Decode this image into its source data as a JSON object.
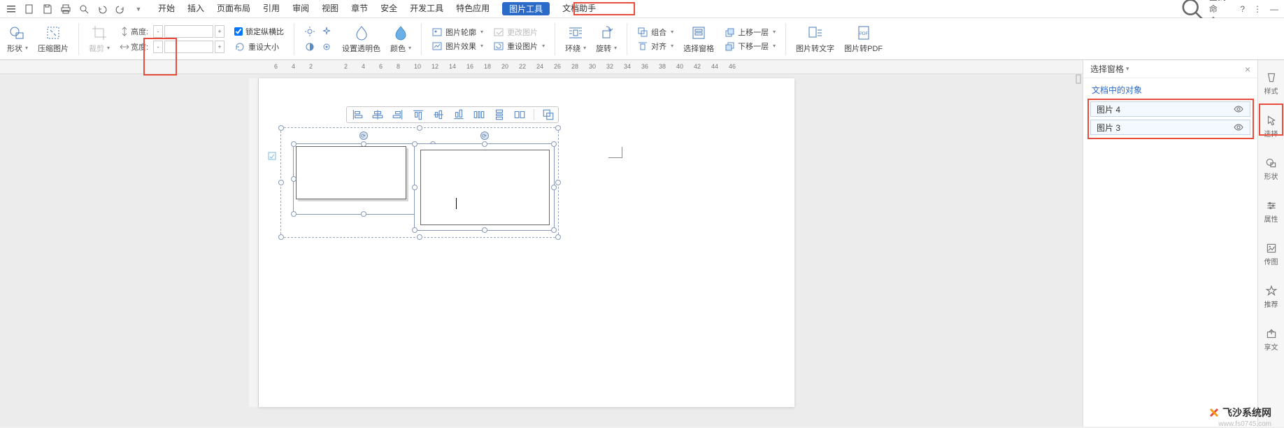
{
  "quick": {
    "search": "查找命令…"
  },
  "tabs": {
    "start": "开始",
    "insert": "插入",
    "layout": "页面布局",
    "ref": "引用",
    "review": "审阅",
    "view": "视图",
    "chapter": "章节",
    "security": "安全",
    "dev": "开发工具",
    "special": "特色应用",
    "pictool": "图片工具",
    "dochelper": "文档助手"
  },
  "ribbon": {
    "shape": "形状",
    "compress": "压缩图片",
    "crop": "裁剪",
    "height": "高度:",
    "width": "宽度:",
    "lock": "锁定纵横比",
    "resetsize": "重设大小",
    "settransp": "设置透明色",
    "color": "颜色",
    "outline": "图片轮廓",
    "effect": "图片效果",
    "change": "更改图片",
    "resetpic": "重设图片",
    "wrap": "环绕",
    "rotate": "旋转",
    "group": "组合",
    "align": "对齐",
    "selpane": "选择窗格",
    "up": "上移一层",
    "down": "下移一层",
    "totext": "图片转文字",
    "topdf": "图片转PDF"
  },
  "ruler": [
    "6",
    "4",
    "2",
    "",
    "2",
    "4",
    "6",
    "8",
    "10",
    "12",
    "14",
    "16",
    "18",
    "20",
    "22",
    "24",
    "26",
    "28",
    "30",
    "32",
    "34",
    "36",
    "38",
    "40",
    "42",
    "44",
    "46"
  ],
  "panel": {
    "title": "选择窗格",
    "subtitle": "文档中的对象",
    "items": [
      {
        "name": "图片 4"
      },
      {
        "name": "图片 3"
      }
    ]
  },
  "strip": {
    "style": "样式",
    "select": "选择",
    "shape": "形状",
    "prop": "属性",
    "chuantu": "传图",
    "recommend": "推荐",
    "share": "享文"
  },
  "watermark": {
    "text": "飞沙系统网",
    "url": "www.fs0745.com"
  }
}
